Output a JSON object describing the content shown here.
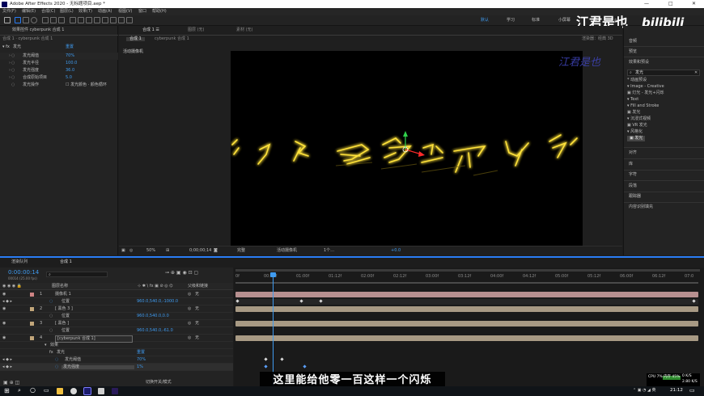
{
  "app": {
    "title": "Adobe After Effects 2020 - 无标题项目.aep *",
    "window_controls": [
      "—",
      "□",
      "✕"
    ]
  },
  "menu": [
    "文件(F)",
    "编辑(E)",
    "合成(C)",
    "图层(L)",
    "效果(T)",
    "动画(A)",
    "视图(V)",
    "窗口",
    "帮助(H)"
  ],
  "workspaces": {
    "items": [
      "默认",
      "学习",
      "标准",
      "小屏幕",
      "库"
    ],
    "active": "默认"
  },
  "watermark": {
    "name": "江君是也",
    "brand": "bilibili",
    "glyph_overlay": "江君是也"
  },
  "effect_controls": {
    "tab": "效果控件 cyberpunk 合成 1",
    "breadcrumb": "合成 1 · cyberpunk 合成 1",
    "effect_name": "发光",
    "reset_label": "重置",
    "params": [
      {
        "name": "发光阈值",
        "value": "70%"
      },
      {
        "name": "发光半径",
        "value": "100.0"
      },
      {
        "name": "发光强度",
        "value": "36.0"
      },
      {
        "name": "合成原始项目",
        "value": "5.0"
      },
      {
        "name": "发光操作",
        "value": "☐ 发光颜色 · 颜色循环"
      }
    ]
  },
  "composition": {
    "tabs": [
      {
        "label": "合成 1 ☰"
      },
      {
        "label": "图层 (无)"
      },
      {
        "label": "素材 (无)"
      }
    ],
    "sub_tabs": [
      "合成 1",
      "cyberpunk 合成 1"
    ],
    "viewer_label": "活动摄像机",
    "renderer": "渲染器：经典 3D",
    "footer": {
      "zoom": "50%",
      "time": "0;00;00;14",
      "quality": "完整",
      "camera": "活动摄像机",
      "views": "1个…",
      "exposure": "+0.0"
    },
    "art_text": "˪ ⺁ ⽍ 吕 ⻖ 户 ⼭ 丬"
  },
  "right_panel": {
    "items": [
      "音频",
      "预览",
      "效果和预设"
    ],
    "search_value": "发光",
    "tree": [
      "* 动画预设",
      "  ▾ Image - Creative",
      "     ▣ 灯光 - 发光+闪烁",
      "  ▾ Text",
      "     ▾ Fill and Stroke",
      "        ▣ 发光",
      "▾ 沉浸式视频",
      "   ▣ VR 发光",
      "▾ 风格化",
      "   ▣ 发光"
    ],
    "lower_items": [
      "对齐",
      "库",
      "字符",
      "段落",
      "跟踪器",
      "内容识别填充"
    ]
  },
  "timeline": {
    "tabs": [
      "渲染队列",
      "合成 1"
    ],
    "current_time": "0:00:00:14",
    "fps": "00014 (25.00 fps)",
    "columns": [
      "图层名称",
      "父级和链接"
    ],
    "layers": [
      {
        "num": "1",
        "name": "摄像机 1",
        "parent": "无"
      },
      {
        "num": "",
        "name": "位置",
        "value": "960.0,540.0,-1000.0"
      },
      {
        "num": "2",
        "name": "[ 黑色 3 ]",
        "parent": "无"
      },
      {
        "num": "",
        "name": "位置",
        "value": "960.0,540.0,0.0"
      },
      {
        "num": "3",
        "name": "[ 黑色 ]",
        "parent": "无"
      },
      {
        "num": "",
        "name": "位置",
        "value": "960.0,540.0,-61.0"
      },
      {
        "num": "4",
        "name": "[cyberpunk 合成 1]",
        "parent": "无"
      },
      {
        "num": "",
        "name": "效果"
      },
      {
        "num": "",
        "name": "发光",
        "value": "重置"
      },
      {
        "num": "",
        "name": "发光阈值",
        "value": "70%"
      },
      {
        "num": "",
        "name": "发光强度",
        "value": "1%"
      }
    ],
    "ruler": [
      "0f",
      "00:12f",
      "01:00f",
      "01:12f",
      "02:00f",
      "02:12f",
      "03:00f",
      "03:12f",
      "04:00f",
      "04:12f",
      "05:00f",
      "05:12f",
      "06:00f",
      "06:12f",
      "07:0"
    ],
    "footer": "切换开关/模式"
  },
  "subtitle": "这里能给他零一百这样一个闪烁",
  "taskbar": {
    "time": "21:12",
    "cpu": "CPU 7%",
    "mem": "内存 45%",
    "net_up": "0 K/S",
    "net_down": "2.80 K/S"
  },
  "colors": {
    "accent": "#2a7df5",
    "yellow_glow": "#ffe23a",
    "bar_tan": "#a89a84",
    "bar_gray": "#707070",
    "label_pink": "#ce8484",
    "label_tan": "#c2a67a"
  }
}
